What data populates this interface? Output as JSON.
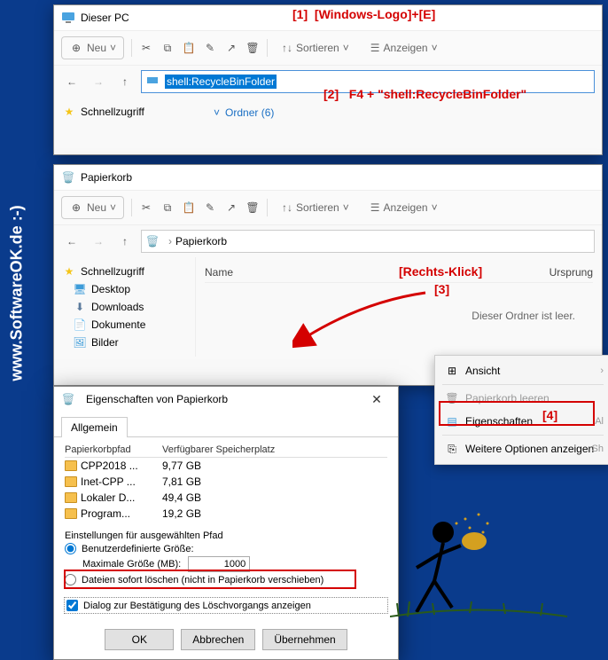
{
  "watermark_left": "www.SoftwareOK.de :-)",
  "annotations": {
    "a1": "[1]",
    "a1_text": "[Windows-Logo]+[E]",
    "a2": "[2]",
    "a2_text": "F4 + \"shell:RecycleBinFolder\"",
    "a3_label": "[Rechts-Klick]",
    "a3": "[3]",
    "a4": "[4]"
  },
  "win1": {
    "title": "Dieser PC",
    "toolbar": {
      "new": "Neu",
      "sort": "Sortieren",
      "view": "Anzeigen"
    },
    "address": "shell:RecycleBinFolder",
    "quick": "Schnellzugriff",
    "folders": "Ordner (6)"
  },
  "win2": {
    "title": "Papierkorb",
    "toolbar": {
      "new": "Neu",
      "sort": "Sortieren",
      "view": "Anzeigen"
    },
    "breadcrumb": "Papierkorb",
    "cols": {
      "name": "Name",
      "origin": "Ursprung"
    },
    "empty": "Dieser Ordner ist leer.",
    "sidebar": {
      "quick": "Schnellzugriff",
      "desktop": "Desktop",
      "downloads": "Downloads",
      "dokumente": "Dokumente",
      "bilder": "Bilder"
    }
  },
  "ctx": {
    "view": "Ansicht",
    "empty": "Papierkorb leeren",
    "props": "Eigenschaften",
    "props_hint": "Al",
    "more": "Weitere Optionen anzeigen",
    "more_hint": "Sh"
  },
  "dlg": {
    "title": "Eigenschaften von Papierkorb",
    "tab": "Allgemein",
    "col_path": "Papierkorbpfad",
    "col_space": "Verfügbarer Speicherplatz",
    "rows": [
      {
        "name": "CPP2018 ...",
        "space": "9,77 GB"
      },
      {
        "name": "Inet-CPP ...",
        "space": "7,81 GB"
      },
      {
        "name": "Lokaler D...",
        "space": "49,4 GB"
      },
      {
        "name": "Program...",
        "space": "19,2 GB"
      }
    ],
    "grp_title": "Einstellungen für ausgewählten Pfad",
    "radio1": "Benutzerdefinierte Größe:",
    "maxsize": "Maximale Größe (MB):",
    "maxsize_val": "1000",
    "radio2": "Dateien sofort löschen (nicht in Papierkorb verschieben)",
    "chk": "Dialog zur Bestätigung des Löschvorgangs anzeigen",
    "ok": "OK",
    "cancel": "Abbrechen",
    "apply": "Übernehmen"
  }
}
